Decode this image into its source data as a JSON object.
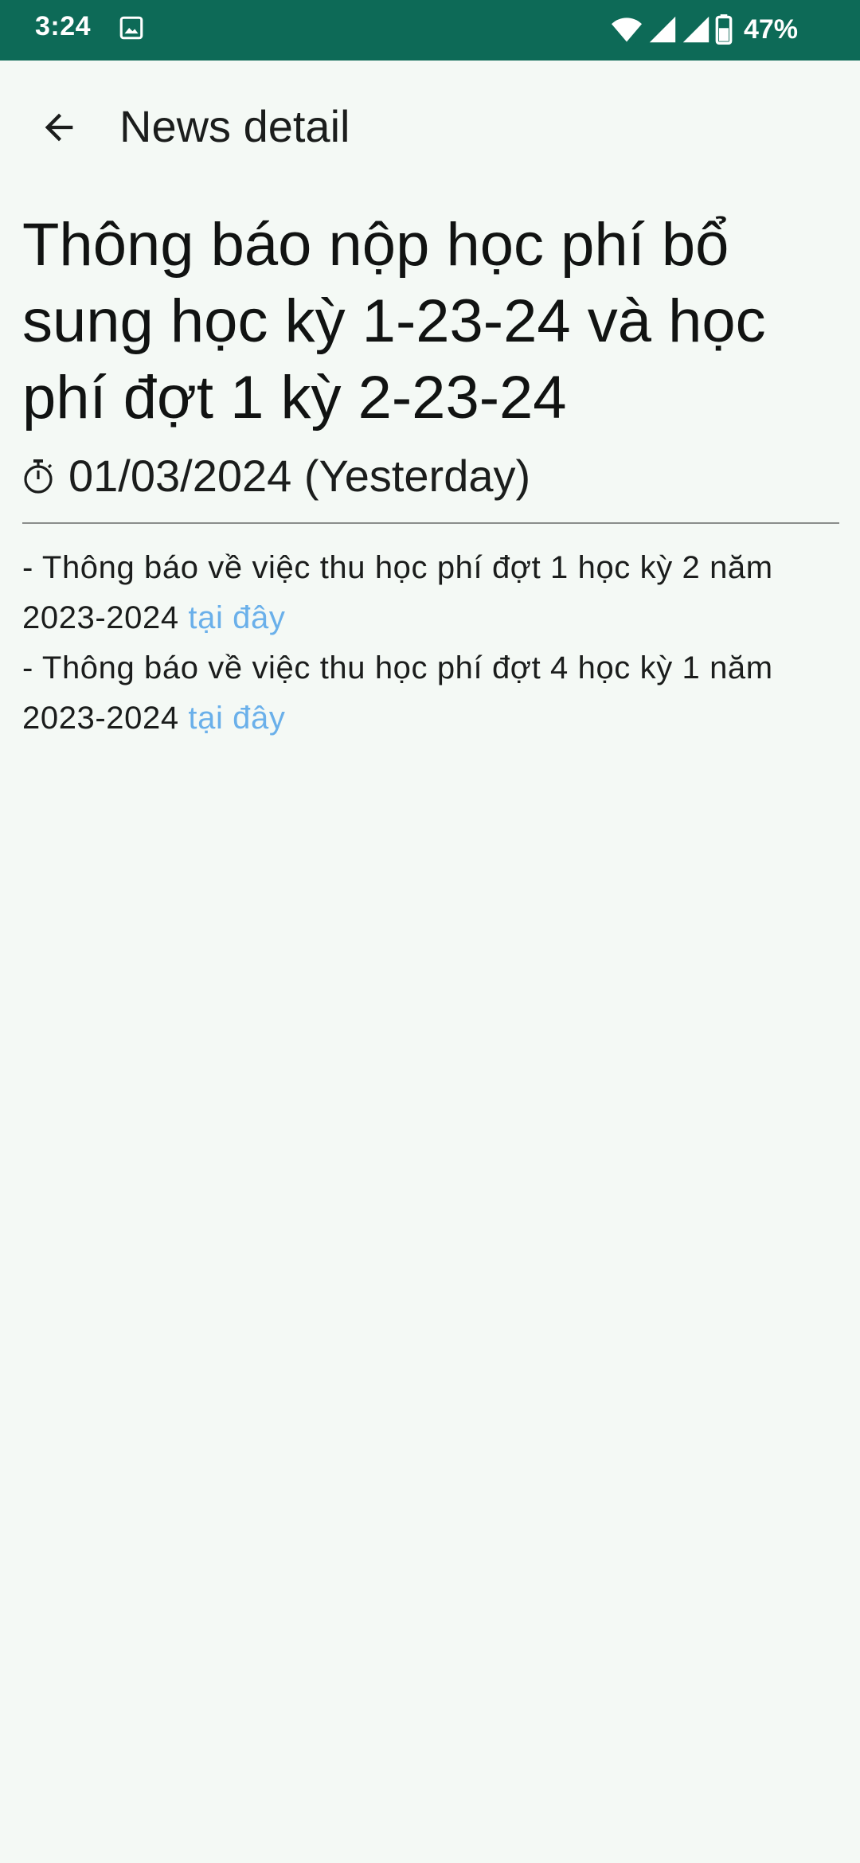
{
  "status_bar": {
    "time": "3:24",
    "battery": "47%",
    "icons": [
      "image-icon",
      "wifi-icon",
      "signal-icon",
      "signal-icon",
      "battery-icon"
    ]
  },
  "app_bar": {
    "title": "News detail",
    "back_icon": "arrow-back-icon"
  },
  "article": {
    "title": "Thông báo nộp học phí bổ sung học kỳ 1-23-24 và học phí đợt 1 kỳ 2-23-24",
    "date": "01/03/2024 (Yesterday)",
    "date_icon": "stopwatch-icon",
    "paragraphs": [
      {
        "text": "- Thông báo về việc thu học phí đợt 1 học kỳ 2 năm 2023-2024 ",
        "link": "tại đây"
      },
      {
        "text": "- Thông báo về việc thu học phí đợt 4 học kỳ 1 năm 2023-2024 ",
        "link": "tại đây"
      }
    ]
  },
  "colors": {
    "status_bar": "#0d6a57",
    "background": "#f4f9f5",
    "link": "#6ab0ea"
  }
}
